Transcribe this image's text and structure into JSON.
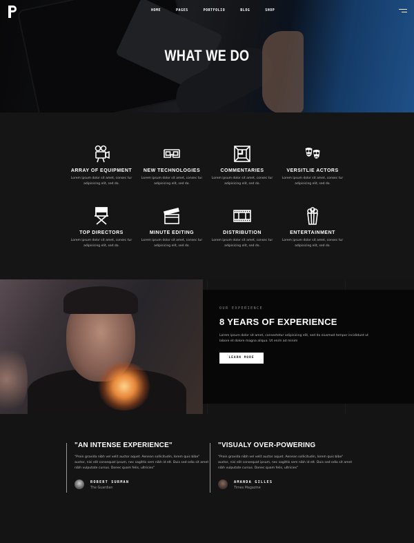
{
  "brand": {
    "logo_letter": "P"
  },
  "nav": {
    "items": [
      "HOME",
      "PAGES",
      "PORTFOLIO",
      "BLOG",
      "SHOP"
    ]
  },
  "hero": {
    "title": "WHAT WE DO"
  },
  "features": [
    {
      "icon": "film-camera-icon",
      "title": "ARRAY OF EQUIPMENT",
      "text": "Lorem ipsum dolor sit amet, consec tur adipisicing elit, sed do."
    },
    {
      "icon": "3d-glasses-icon",
      "title": "NEW TECHNOLOGIES",
      "text": "Lorem ipsum dolor sit amet, consec tur adipisicing elit, sed do."
    },
    {
      "icon": "frame-icon",
      "title": "COMMENTARIES",
      "text": "Lorem ipsum dolor sit amet, consec tur adipisicing elit, sed do."
    },
    {
      "icon": "theater-masks-icon",
      "title": "VERSITLIE ACTORS",
      "text": "Lorem ipsum dolor sit amet, consec tur adipisicing elit, sed do."
    },
    {
      "icon": "director-chair-icon",
      "title": "TOP DIRECTORS",
      "text": "Lorem ipsum dolor sit amet, consec tur adipisicing elit, sed do."
    },
    {
      "icon": "clapperboard-icon",
      "title": "MINUTE EDITING",
      "text": "Lorem ipsum dolor sit amet, consec tur adipisicing elit, sed do."
    },
    {
      "icon": "film-strip-icon",
      "title": "DISTRIBUTION",
      "text": "Lorem ipsum dolor sit amet, consec tur adipisicing elit, sed do."
    },
    {
      "icon": "popcorn-icon",
      "title": "ENTERTAINMENT",
      "text": "Lorem ipsum dolor sit amet, consec tur adipisicing elit, sed do."
    }
  ],
  "experience": {
    "eyebrow": "OUR EXPERIENCE",
    "title": "8 YEARS OF EXPERIENCE",
    "text": "Lorem ipsum dolor sit amet, consectetur adipisicing elit, sed do eiusmod tempor incididunt ut labore et dolore magna aliqua. Ut enim ad minim",
    "button": "LEARN MORE"
  },
  "testimonials": [
    {
      "title": "\"AN INTENSE EXPERIENCE\"",
      "text": "\"Proin gravida nibh vel velit auctor aquet. Aenean sollicitudin, lorem quis bibe\" auctor, nisi elit consequat ipsum, nec sagittis sem nibh id elt. Duis sed odio sit amet nibh vulputate cursus. Donec quam felis, ultricies\"",
      "name": "ROBERT SURMAN",
      "org": "The Guardian"
    },
    {
      "title": "\"VISUALY OVER-POWERING",
      "text": "\"Proin gravida nibh vel velit auctor aquet. Aenean sollicitudin, lorem quis bibe\" auctor, nisi elit consequat ipsum, nec sagittis sem nibh id elt. Duis sed odio sit amet nibh vulputate cursus. Donec quam felis, ultricies\"",
      "name": "AMANDA GILLES",
      "org": "Times Magazine"
    }
  ]
}
